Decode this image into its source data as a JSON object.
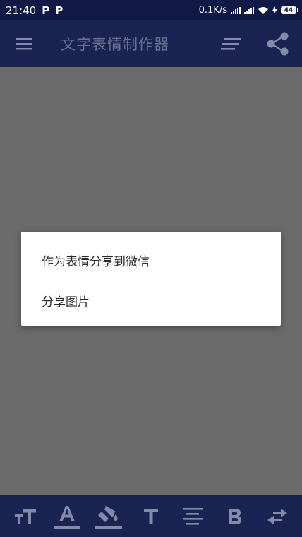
{
  "status_bar": {
    "time": "21:40",
    "notif_1": "P",
    "notif_2": "P",
    "net_speed": "0.1K/s",
    "battery": "44"
  },
  "app_bar": {
    "title": "文字表情制作器",
    "menu_icon": "menu-icon",
    "align_icon": "text-align-icon",
    "share_icon": "share-icon"
  },
  "dialog": {
    "items": [
      {
        "label": "作为表情分享到微信"
      },
      {
        "label": "分享图片"
      }
    ]
  },
  "toolbar": {
    "tools": [
      {
        "name": "text-size-icon"
      },
      {
        "name": "text-color-icon",
        "color": "#858aa6"
      },
      {
        "name": "fill-color-icon",
        "color": "#858aa6"
      },
      {
        "name": "font-icon"
      },
      {
        "name": "align-center-icon"
      },
      {
        "name": "bold-icon"
      },
      {
        "name": "swap-direction-icon"
      }
    ]
  },
  "colors": {
    "status_bar": "#111a46",
    "app_bar": "#1a2452",
    "overlay": "#6b6b6b",
    "title_text": "#6b7094",
    "icon_muted": "#858aa6"
  }
}
